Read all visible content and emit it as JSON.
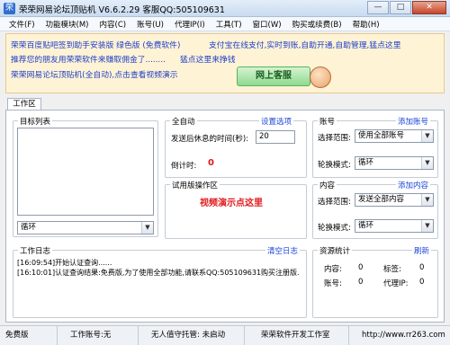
{
  "window": {
    "title": "荣荣网易论坛顶贴机 V6.6.2.29  客服QQ:505109631",
    "btn_min": "—",
    "btn_max": "□",
    "btn_close": "✕"
  },
  "menu": [
    "文件(F)",
    "功能模块(M)",
    "内容(C)",
    "账号(U)",
    "代理IP(I)",
    "工具(T)",
    "窗口(W)",
    "购买或续费(B)",
    "帮助(H)"
  ],
  "banner": {
    "line1a": "荣荣百度贴吧签到助手安装版 绿色版 (免费软件)",
    "line1b": "支付宝在线支付,实时到账,自助开通,自助管理,猛点这里",
    "line2a": "推荐您的朋友用荣荣软件来赚取佣金了........",
    "line2b": "猛点这里来挣钱",
    "line3": "荣荣网易论坛顶贴机(全自动),点击查看视频演示",
    "service": "网上客服"
  },
  "tab": "工作区",
  "target_list": {
    "title": "目标列表",
    "select": "循环"
  },
  "auto": {
    "title": "全自动",
    "link": "设置选项",
    "rest_label": "发送后休息的时间(秒):",
    "rest_value": "20",
    "countdown_label": "倒计时:",
    "countdown_value": "0"
  },
  "trial": {
    "title": "试用版操作区",
    "video_link": "视频演示点这里"
  },
  "account": {
    "title": "账号",
    "link": "添加账号",
    "scope_label": "选择范围:",
    "scope_value": "使用全部账号",
    "mode_label": "轮换模式:",
    "mode_value": "循环"
  },
  "content": {
    "title": "内容",
    "link": "添加内容",
    "scope_label": "选择范围:",
    "scope_value": "发送全部内容",
    "mode_label": "轮换模式:",
    "mode_value": "循环"
  },
  "log": {
    "title": "工作日志",
    "link": "清空日志",
    "lines": [
      "[16:09:54]开始认证查询......",
      "[16:10:01]认证查询结果:免费版,为了使用全部功能,请联系QQ:505109631购买注册版."
    ]
  },
  "stats": {
    "title": "资源统计",
    "link": "刷新",
    "content_label": "内容:",
    "content_value": "0",
    "tag_label": "标签:",
    "tag_value": "0",
    "account_label": "账号:",
    "account_value": "0",
    "proxy_label": "代理IP:",
    "proxy_value": "0"
  },
  "status": {
    "edition": "免费版",
    "work_account": "工作账号:无",
    "unattended": "无人值守托管: 未启动",
    "studio": "荣荣软件开发工作室",
    "url": "http://www.rr263.com"
  }
}
